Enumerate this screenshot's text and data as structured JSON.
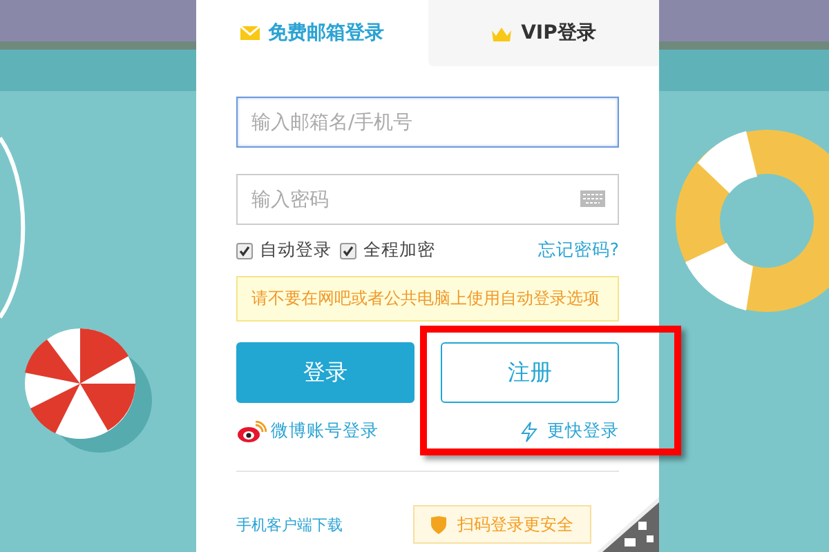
{
  "tabs": [
    {
      "label": "免费邮箱登录",
      "kind": "mail",
      "selected": true
    },
    {
      "label": "VIP登录",
      "kind": "vip",
      "selected": false
    }
  ],
  "account_field": {
    "placeholder": "输入邮箱名/手机号",
    "focused": true
  },
  "password_field": {
    "placeholder": "输入密码"
  },
  "options": [
    {
      "label": "自动登录",
      "checked": true
    },
    {
      "label": "全程加密",
      "checked": true
    }
  ],
  "forgot_link": "忘记密码?",
  "notice": "请不要在网吧或者公共电脑上使用自动登录选项",
  "login_button": "登录",
  "register_button": {
    "label": "注册",
    "highlighted": true
  },
  "weibo_link": "微博账号登录",
  "fast_login_link": "更快登录",
  "mobile_link": "手机客户端下载",
  "qr_tip": "扫码登录更安全"
}
